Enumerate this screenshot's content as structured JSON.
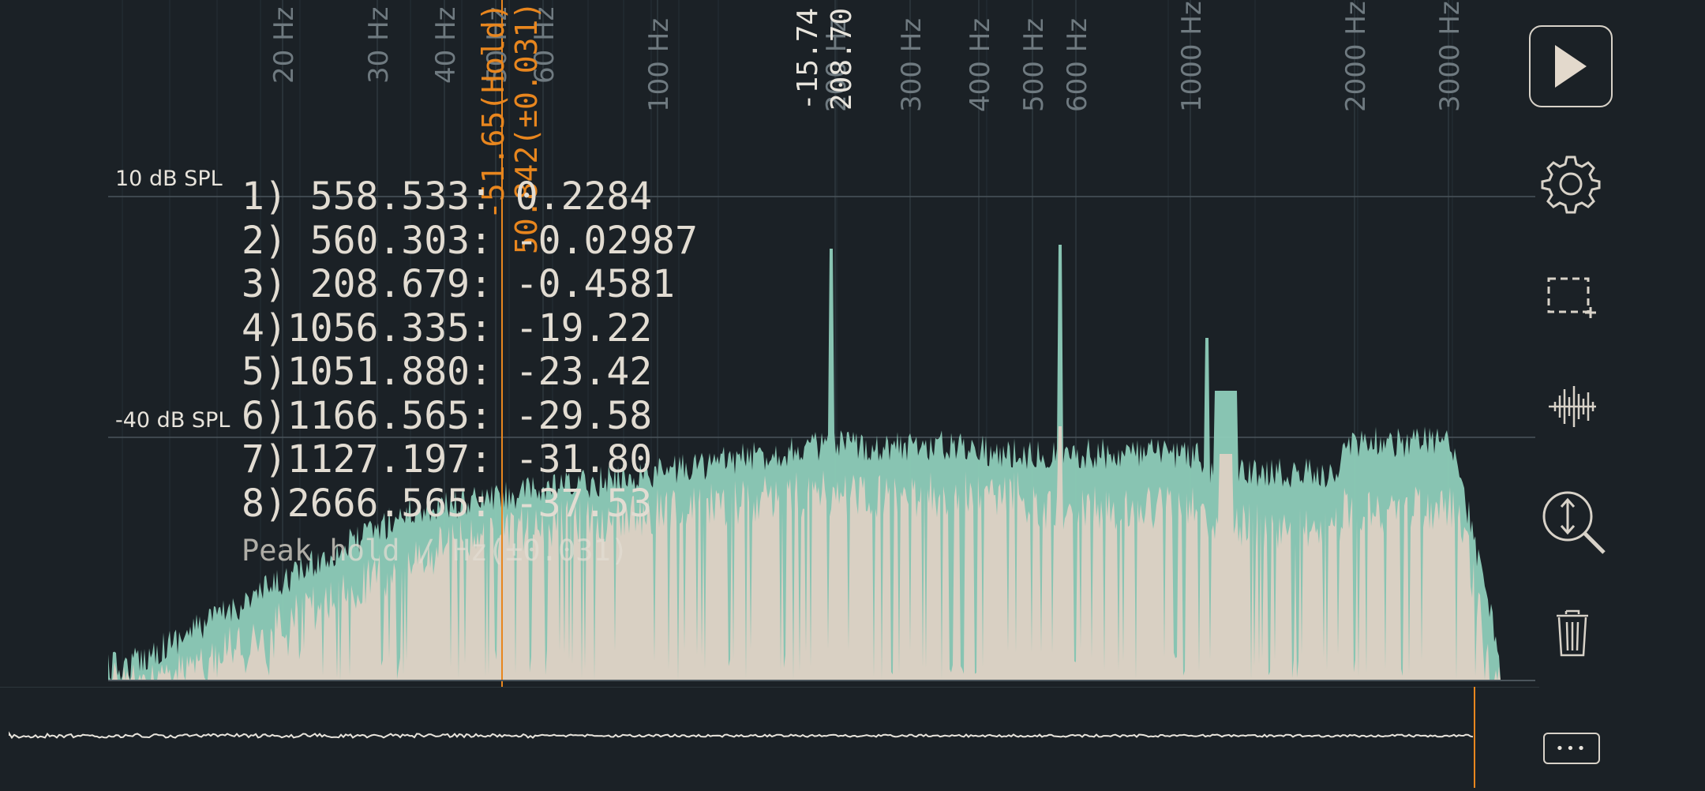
{
  "spectrum": {
    "freq_labels": [
      "20 Hz",
      "30 Hz",
      "40 Hz",
      "50 Hz",
      "60 Hz",
      "100 Hz",
      "200 Hz",
      "300 Hz",
      "400 Hz",
      "500 Hz",
      "600 Hz",
      "1000 Hz",
      "2000 Hz",
      "3000 Hz"
    ],
    "db_labels": [
      "10 dB SPL",
      "-40 dB SPL"
    ],
    "hold_readout": {
      "level": "-51.65(Hold)",
      "freq": "50.842(±0.031)"
    },
    "cursor_readout": {
      "level": "-15.74",
      "freq": "208.70"
    },
    "peaks": [
      {
        "index": "1)",
        "freq": " 558.533",
        "value": "0.2284"
      },
      {
        "index": "2)",
        "freq": " 560.303",
        "value": "-0.02987"
      },
      {
        "index": "3)",
        "freq": " 208.679",
        "value": "-0.4581"
      },
      {
        "index": "4)",
        "freq": "1056.335",
        "value": "-19.22"
      },
      {
        "index": "5)",
        "freq": "1051.880",
        "value": "-23.42"
      },
      {
        "index": "6)",
        "freq": "1166.565",
        "value": "-29.58"
      },
      {
        "index": "7)",
        "freq": "1127.197",
        "value": "-31.80"
      },
      {
        "index": "8)",
        "freq": "2666.565",
        "value": "-37.53"
      }
    ],
    "peak_hold_note": "Peak hold / Hz(±0.031)",
    "colors": {
      "live": "#d9d0c3",
      "hold": "#8ecdb9",
      "cursor": "#e8861e",
      "grid": "#3a444b"
    }
  },
  "toolbar": {
    "icons": [
      "play-icon",
      "gear-icon",
      "selection-icon",
      "waveform-icon",
      "zoom-vertical-icon",
      "trash-icon",
      "more-icon"
    ],
    "more_label": "•••"
  }
}
